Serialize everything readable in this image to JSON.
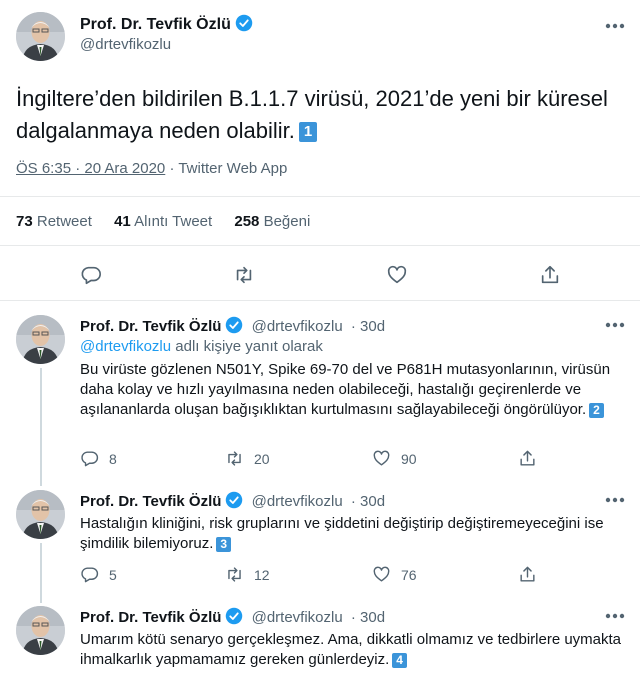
{
  "main_tweet": {
    "author_name": "Prof. Dr. Tevfik Özlü",
    "author_handle": "@drtevfikozlu",
    "text": "İngiltere’den bildirilen B.1.1.7 virüsü, 2021’de yeni bir küresel dalgalanmaya neden olabilir.",
    "badge": "1",
    "time": "ÖS 6:35 · 20 Ara 2020",
    "source": "· Twitter Web App",
    "retweets_count": "73",
    "retweets_label": "Retweet",
    "quotes_count": "41",
    "quotes_label": "Alıntı Tweet",
    "likes_count": "258",
    "likes_label": "Beğeni"
  },
  "replies": [
    {
      "author_name": "Prof. Dr. Tevfik Özlü",
      "author_handle": "@drtevfikozlu",
      "age": "· 30d",
      "replying_handle": "@drtevfikozlu",
      "replying_label": "adlı kişiye yanıt olarak",
      "text": "Bu virüste gözlenen N501Y, Spike 69-70 del ve P681H mutasyonlarının, virüsün daha kolay ve hızlı yayılmasına neden olabileceği, hastalığı geçirenlerde ve aşılananlarda oluşan bağışıklıktan kurtulmasını sağlayabileceği öngörülüyor.",
      "badge": "2",
      "replies": "8",
      "retweets": "20",
      "likes": "90"
    },
    {
      "author_name": "Prof. Dr. Tevfik Özlü",
      "author_handle": "@drtevfikozlu",
      "age": "· 30d",
      "text": "Hastalığın kliniğini, risk gruplarını ve şiddetini değiştirip değiştiremeyeceğini ise şimdilik bilemiyoruz.",
      "badge": "3",
      "replies": "5",
      "retweets": "12",
      "likes": "76"
    },
    {
      "author_name": "Prof. Dr. Tevfik Özlü",
      "author_handle": "@drtevfikozlu",
      "age": "· 30d",
      "text": "Umarım kötü senaryo gerçekleşmez. Ama, dikkatli olmamız ve tedbirlere uymakta ihmalkarlık yapmamamız gereken günlerdeyiz.",
      "badge": "4"
    }
  ],
  "colors": {
    "accent": "#1d9bf0",
    "badge": "#3b94d9",
    "text": "#0f1419",
    "muted": "#536471",
    "divider": "#e7e9ea"
  },
  "icons": [
    "verified-badge-icon",
    "more-options-icon",
    "reply-icon",
    "retweet-icon",
    "like-icon",
    "share-icon"
  ]
}
